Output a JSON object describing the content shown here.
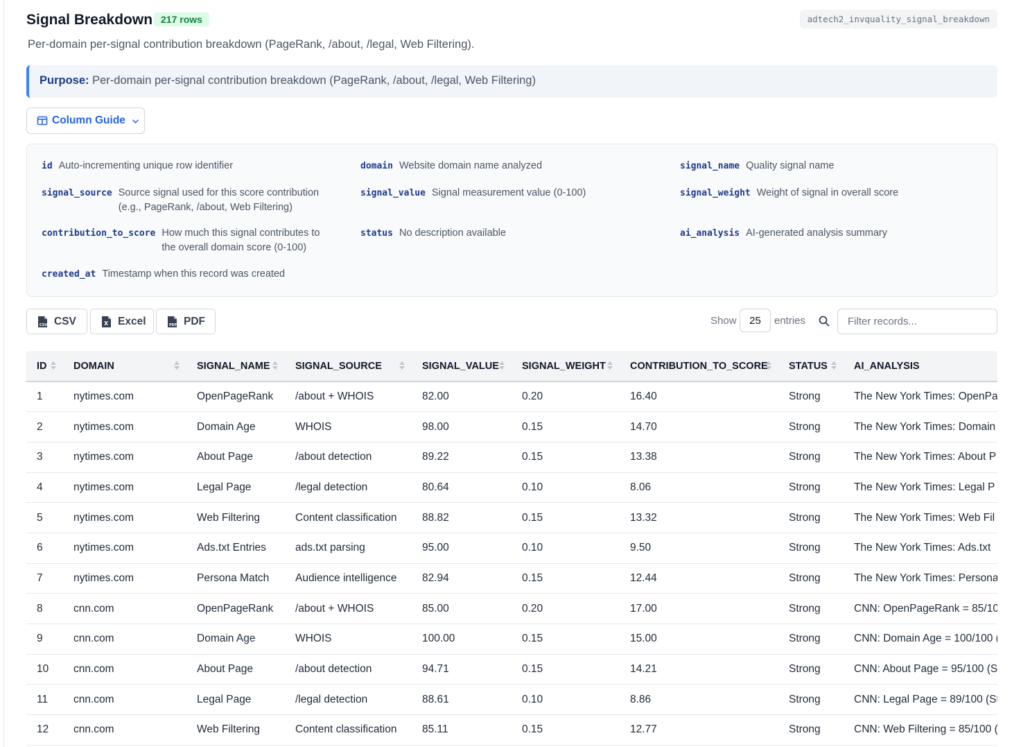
{
  "header": {
    "title": "Signal Breakdown",
    "rows_badge": "217 rows",
    "table_name": "adtech2_invquality_signal_breakdown",
    "subtitle": "Per-domain per-signal contribution breakdown (PageRank, /about, /legal, Web Filtering)."
  },
  "purpose": {
    "label": "Purpose:",
    "text": "Per-domain per-signal contribution breakdown (PageRank, /about, /legal, Web Filtering)"
  },
  "column_guide": {
    "button_label": "Column Guide",
    "items": [
      {
        "name": "id",
        "desc": "Auto-incrementing unique row identifier"
      },
      {
        "name": "domain",
        "desc": "Website domain name analyzed"
      },
      {
        "name": "signal_name",
        "desc": "Quality signal name"
      },
      {
        "name": "signal_source",
        "desc": "Source signal used for this score contribution (e.g., PageRank, /about, Web Filtering)"
      },
      {
        "name": "signal_value",
        "desc": "Signal measurement value (0-100)"
      },
      {
        "name": "signal_weight",
        "desc": "Weight of signal in overall score"
      },
      {
        "name": "contribution_to_score",
        "desc": "How much this signal contributes to the overall domain score (0-100)"
      },
      {
        "name": "status",
        "desc": "No description available"
      },
      {
        "name": "ai_analysis",
        "desc": "AI-generated analysis summary"
      },
      {
        "name": "created_at",
        "desc": "Timestamp when this record was created"
      }
    ]
  },
  "toolbar": {
    "export_buttons": [
      "CSV",
      "Excel",
      "PDF"
    ],
    "show_label": "Show",
    "page_length": "25",
    "entries_label": "entries",
    "filter_placeholder": "Filter records..."
  },
  "table": {
    "columns": [
      "ID",
      "DOMAIN",
      "SIGNAL_NAME",
      "SIGNAL_SOURCE",
      "SIGNAL_VALUE",
      "SIGNAL_WEIGHT",
      "CONTRIBUTION_TO_SCORE",
      "STATUS",
      "AI_ANALYSIS"
    ],
    "rows": [
      [
        "1",
        "nytimes.com",
        "OpenPageRank",
        "/about + WHOIS",
        "82.00",
        "0.20",
        "16.40",
        "Strong",
        "The New York Times: OpenPa"
      ],
      [
        "2",
        "nytimes.com",
        "Domain Age",
        "WHOIS",
        "98.00",
        "0.15",
        "14.70",
        "Strong",
        "The New York Times: Domain"
      ],
      [
        "3",
        "nytimes.com",
        "About Page",
        "/about detection",
        "89.22",
        "0.15",
        "13.38",
        "Strong",
        "The New York Times: About P"
      ],
      [
        "4",
        "nytimes.com",
        "Legal Page",
        "/legal detection",
        "80.64",
        "0.10",
        "8.06",
        "Strong",
        "The New York Times: Legal P"
      ],
      [
        "5",
        "nytimes.com",
        "Web Filtering",
        "Content classification",
        "88.82",
        "0.15",
        "13.32",
        "Strong",
        "The New York Times: Web Fil"
      ],
      [
        "6",
        "nytimes.com",
        "Ads.txt Entries",
        "ads.txt parsing",
        "95.00",
        "0.10",
        "9.50",
        "Strong",
        "The New York Times: Ads.txt"
      ],
      [
        "7",
        "nytimes.com",
        "Persona Match",
        "Audience intelligence",
        "82.94",
        "0.15",
        "12.44",
        "Strong",
        "The New York Times: Persona"
      ],
      [
        "8",
        "cnn.com",
        "OpenPageRank",
        "/about + WHOIS",
        "85.00",
        "0.20",
        "17.00",
        "Strong",
        "CNN: OpenPageRank = 85/10"
      ],
      [
        "9",
        "cnn.com",
        "Domain Age",
        "WHOIS",
        "100.00",
        "0.15",
        "15.00",
        "Strong",
        "CNN: Domain Age = 100/100 ("
      ],
      [
        "10",
        "cnn.com",
        "About Page",
        "/about detection",
        "94.71",
        "0.15",
        "14.21",
        "Strong",
        "CNN: About Page = 95/100 (S"
      ],
      [
        "11",
        "cnn.com",
        "Legal Page",
        "/legal detection",
        "88.61",
        "0.10",
        "8.86",
        "Strong",
        "CNN: Legal Page = 89/100 (St"
      ],
      [
        "12",
        "cnn.com",
        "Web Filtering",
        "Content classification",
        "85.11",
        "0.15",
        "12.77",
        "Strong",
        "CNN: Web Filtering = 85/100 ("
      ]
    ]
  }
}
